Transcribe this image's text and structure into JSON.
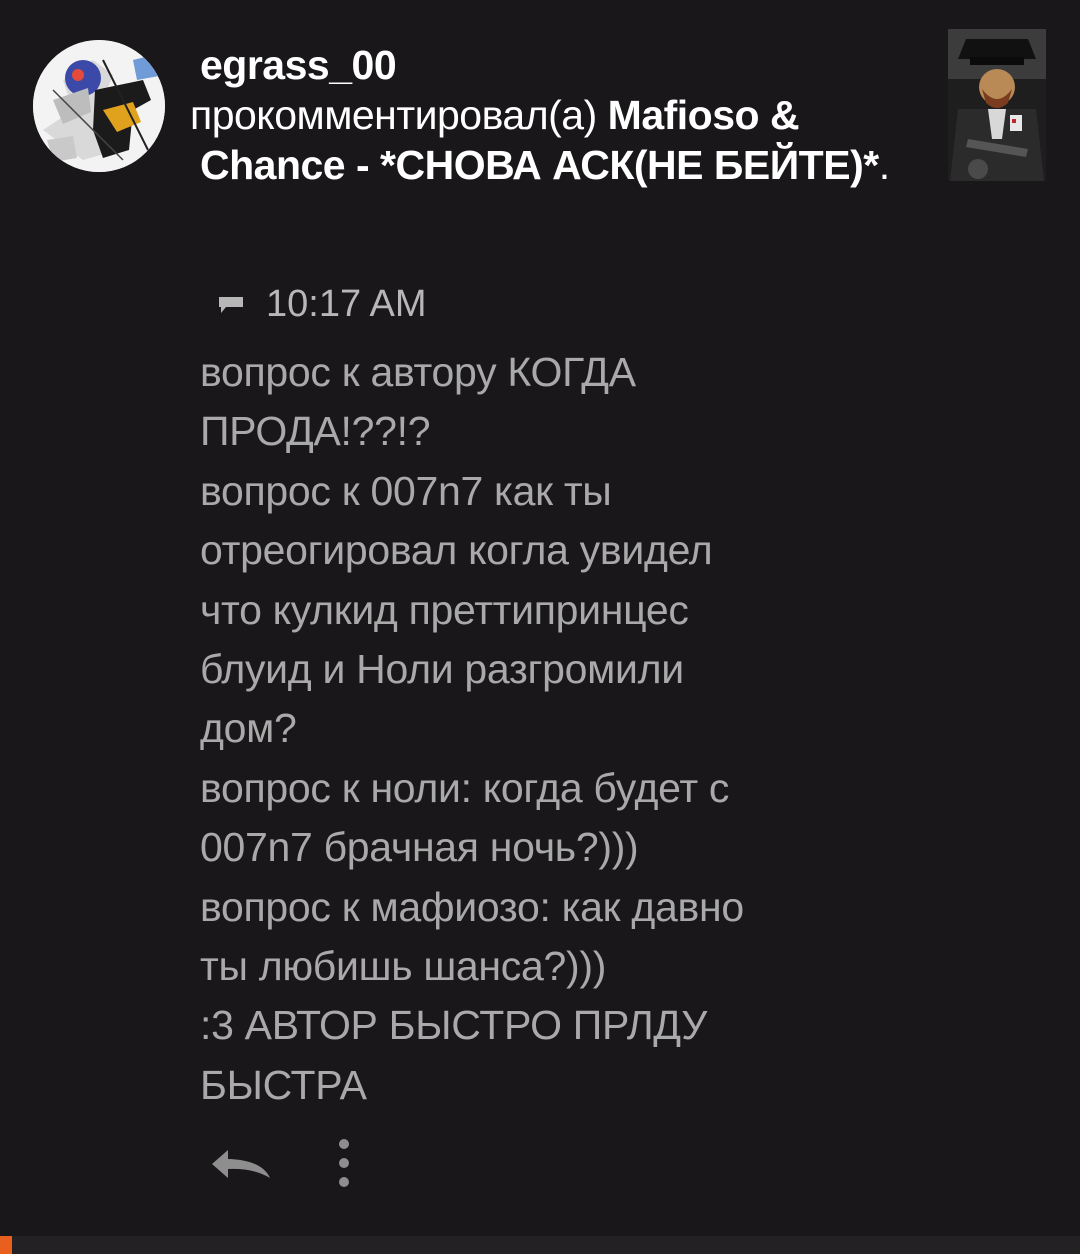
{
  "notification": {
    "username": "egrass_00",
    "action_text": " прокомментировал(а) ",
    "post_title": "Mafioso & Chance - *СНОВА АСК(НЕ БЕЙТЕ)*",
    "trailing": ".",
    "time": "10:17 AM",
    "comment_lines": [
      "вопрос к автору КОГДА",
      "ПРОДА!??!?",
      "вопрос к 007n7 как ты",
      "отреогировал когла увидел",
      "что кулкид преттипринцес",
      "блуид и Ноли разгромили",
      "дом?",
      "вопрос к ноли: когда будет с",
      "007n7 брачная ночь?)))",
      "вопрос к мафиозо: как давно",
      "ты любишь шанса?)))",
      ":3 АВТОР БЫСТРО ПРЛДУ",
      "БЫСТРА"
    ]
  },
  "icons": {
    "comment": "comment-bubble-icon",
    "reply": "reply-arrow-icon",
    "more": "vertical-dots-icon"
  },
  "colors": {
    "background": "#19171a",
    "header_text": "#ffffff",
    "comment_text": "#a9a9a9",
    "meta_text": "#b7b7b7",
    "accent": "#e9601e"
  }
}
